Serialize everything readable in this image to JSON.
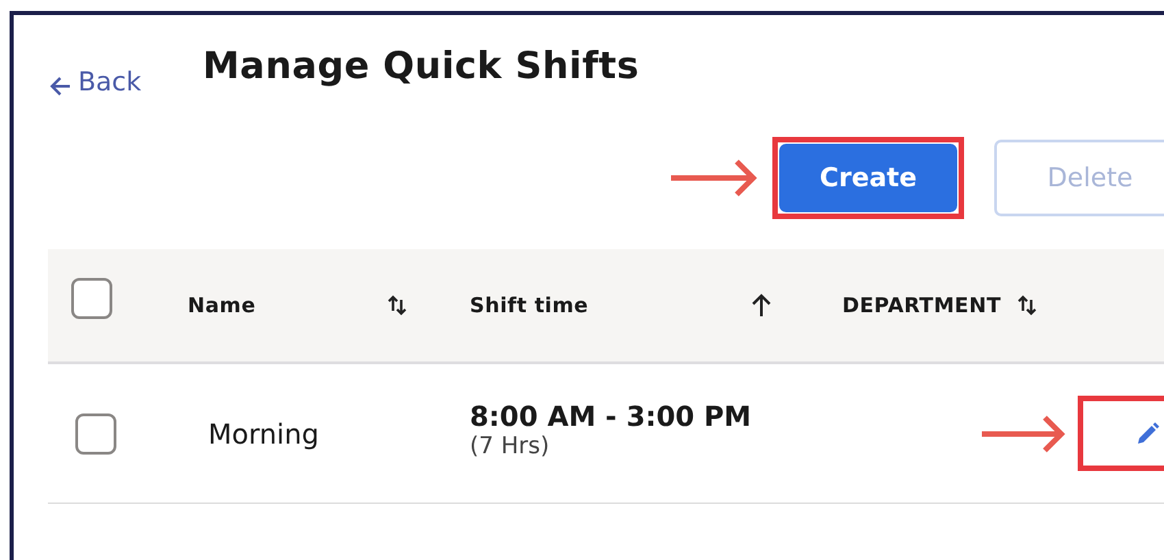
{
  "back_link": {
    "label": "Back"
  },
  "title": "Manage Quick Shifts",
  "actions": [
    {
      "kind": "primary",
      "label": "Create",
      "highlighted": true
    },
    {
      "kind": "secondary",
      "label": "Delete",
      "highlighted": false
    }
  ],
  "table": {
    "select_all": {
      "checked": false
    },
    "columns": [
      {
        "label": "Name",
        "kind": "sortable"
      },
      {
        "label": "Shift time",
        "kind": "ascending"
      },
      {
        "label": "DEPARTMENT",
        "kind": "sortable"
      }
    ],
    "rows": [
      {
        "checked": false,
        "name": "Morning",
        "time": "8:00 AM - 3:00 PM",
        "duration": "(7 Hrs)",
        "edit_highlighted": true
      }
    ]
  }
}
